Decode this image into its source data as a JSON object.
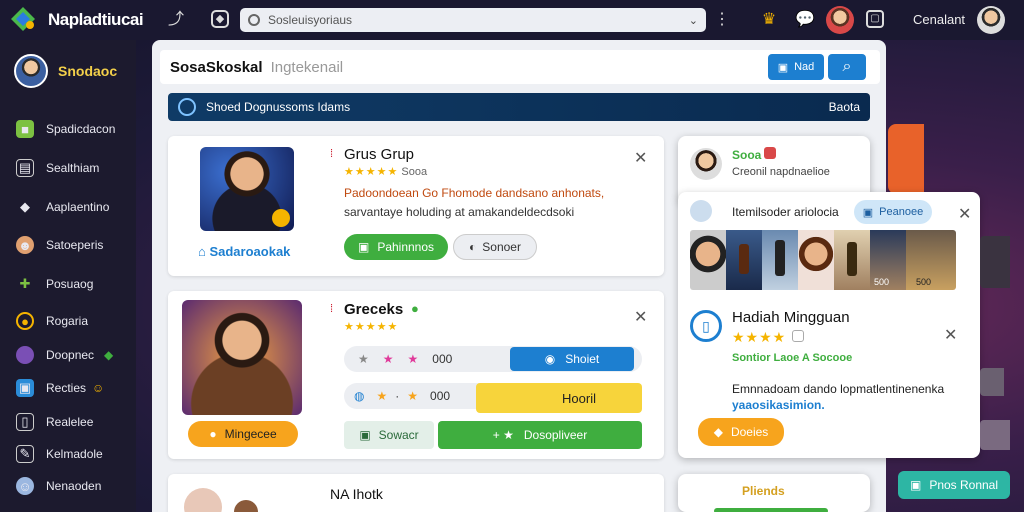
{
  "app": {
    "title": "Napladtiucai",
    "search_text": "Sosleuisyoriaus",
    "user_name": "Cenalant"
  },
  "sidebar": {
    "profile_name": "Snodaoc",
    "items": [
      {
        "label": "Spadicdacon",
        "icon": "cube-icon"
      },
      {
        "label": "Sealthiam",
        "icon": "card-icon"
      },
      {
        "label": "Aaplaentino",
        "icon": "diamond-icon"
      },
      {
        "label": "Satoeperis",
        "icon": "user-icon"
      },
      {
        "label": "Posuaog",
        "icon": "puzzle-icon"
      },
      {
        "label": "Rogaria",
        "icon": "coin-icon"
      },
      {
        "label": "Doopnec",
        "icon": "circle-icon"
      },
      {
        "label": "Recties",
        "icon": "folder-icon"
      },
      {
        "label": "Realelee",
        "icon": "doc-icon"
      },
      {
        "label": "Kelmadole",
        "icon": "note-icon"
      },
      {
        "label": "Nenaoden",
        "icon": "avatar-icon"
      }
    ]
  },
  "main": {
    "header_title": "SosaSkoskal",
    "header_sub": "Ingtekenail",
    "new_label": "Nad",
    "banner_text": "Shoed Dognussoms Idams",
    "banner_right": "Baota",
    "card1": {
      "title": "Grus Grup",
      "rating": "★★★★★",
      "rating_text": "Sooa",
      "desc1": "Padoondoean Go Fhomode dandsano anhonats,",
      "desc2": "sarvantaye holuding at amakandeldecdsoki",
      "caption": "Sadaroaokak",
      "btn_primary": "Pahinnnos",
      "btn_secondary": "Sonoer"
    },
    "card2": {
      "title": "Greceks",
      "rating": "★★★★★",
      "stat_row1_value": "000",
      "stat_row1_btn": "Shoiet",
      "stat_row2_value": "000",
      "stat_row2_btn": "Hooril",
      "stat_row3_label": "Sowacr",
      "stat_row3_btn": "Dosopliveer",
      "bottom_btn": "Mingecee"
    },
    "card3": {
      "title": "NA Ihotk"
    }
  },
  "right": {
    "card_top": {
      "name": "Sooa",
      "sub": "Creonil napdnaelioe"
    },
    "popup": {
      "title": "Itemilsoder ariolocia",
      "chip": "Peanoee",
      "thumb_value_1": "500",
      "thumb_value_2": "500",
      "reward_title": "Hadiah Mingguan",
      "reward_stars": "★★★★",
      "reward_sub": "Sontior Laoe A Socooe",
      "reward_desc1": "Emnnadoam dando lopmatlentinenenka",
      "reward_desc2": "yaaosikasimion.",
      "reward_btn": "Doeies"
    },
    "bottom_label": "Pliends",
    "float_btn": "Pnos Ronnal"
  },
  "colors": {
    "accent_blue": "#1d7fd0",
    "green": "#3fae3f",
    "yellow": "#f7d43b",
    "orange": "#f7a41d",
    "teal": "#2db6a4"
  }
}
